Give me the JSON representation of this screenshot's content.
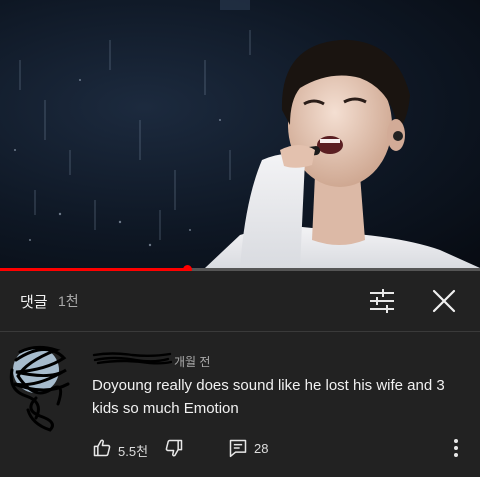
{
  "video": {
    "progress": 0.39
  },
  "comments_header": {
    "title": "댓글",
    "count": "1천"
  },
  "comment": {
    "time": "개월 전",
    "text": "Doyoung really does sound like he lost his wife and 3 kids so much Emotion",
    "likes": "5.5천",
    "replies": "28"
  },
  "icons": {
    "sort": "sort-sliders-icon",
    "close": "close-icon",
    "like": "thumbs-up-icon",
    "dislike": "thumbs-down-icon",
    "reply": "reply-icon",
    "more": "more-vertical-icon"
  },
  "colors": {
    "panel_bg": "#222222",
    "progress": "#ff0000",
    "text_primary": "#f1f1f1",
    "text_secondary": "#aaaaaa"
  }
}
